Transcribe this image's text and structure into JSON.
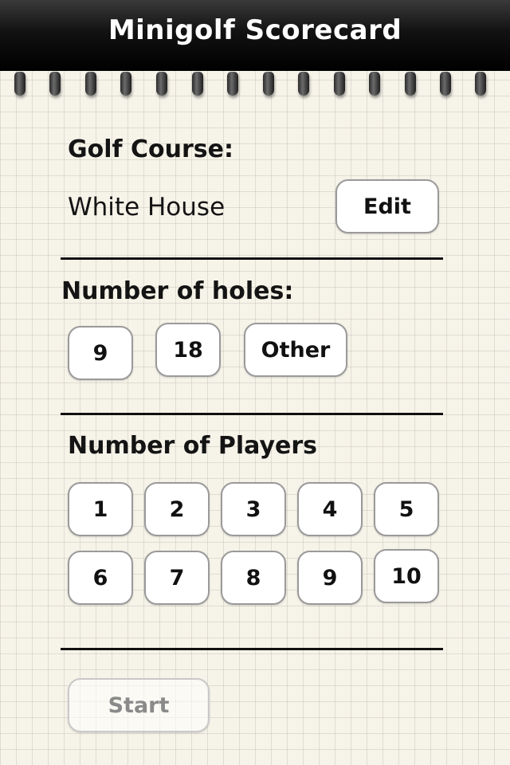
{
  "app": {
    "title": "Minigolf Scorecard"
  },
  "course": {
    "label": "Golf Course:",
    "name": "White House",
    "edit_label": "Edit"
  },
  "holes": {
    "label": "Number of holes:",
    "options": [
      "9",
      "18",
      "Other"
    ]
  },
  "players": {
    "label": "Number of Players",
    "options": [
      "1",
      "2",
      "3",
      "4",
      "5",
      "6",
      "7",
      "8",
      "9",
      "10"
    ]
  },
  "start": {
    "label": "Start",
    "enabled": false
  },
  "colors": {
    "title_bar": "#000000",
    "paper": "#f6f3e9",
    "button_bg": "#ffffff"
  }
}
